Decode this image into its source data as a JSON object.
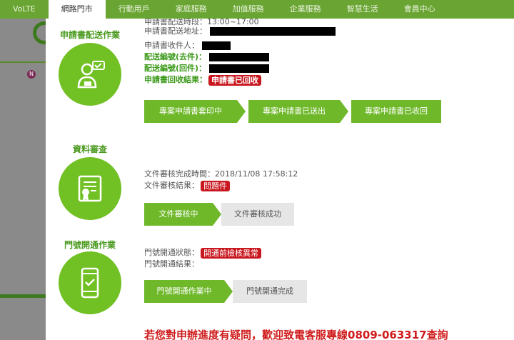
{
  "topnav": {
    "items": [
      {
        "label": "VoLTE"
      },
      {
        "label": "網路門市"
      },
      {
        "label": "行動用戶"
      },
      {
        "label": "家庭服務"
      },
      {
        "label": "加值服務"
      },
      {
        "label": "企業服務"
      },
      {
        "label": "智慧生活"
      },
      {
        "label": "會員中心"
      }
    ],
    "active_index": 1
  },
  "application": {
    "title": "申請書配送作業",
    "icon": "person-presentation-icon",
    "partial_top_text": "申請書配送時段：13:00~17:00",
    "rows": {
      "address_label": "申請書配送地址：",
      "recipient_label": "申請書收件人：",
      "delivery_out_label": "配送編號(去件)：",
      "delivery_back_label": "配送編號(回件)：",
      "result_label": "申請書回收結果：",
      "result_badge": "申請書已回收"
    },
    "steps": [
      "專案申請書套印中",
      "專案申請書已送出",
      "專案申請書已收回"
    ]
  },
  "review": {
    "title": "資料審查",
    "icon": "document-certificate-icon",
    "completed_label": "文件審核完成時間：",
    "completed_time": "2018/11/08 17:58:12",
    "result_label": "文件審核結果：",
    "result_badge": "問題件",
    "steps": [
      "文件審核中",
      "文件審核成功"
    ]
  },
  "activation": {
    "title": "門號開通作業",
    "icon": "smartphone-check-icon",
    "status_label": "門號開通狀態：",
    "status_badge": "開通前檢核異常",
    "result_label": "門號開通結果：",
    "steps": [
      "門號開通作業中",
      "門號開通完成"
    ]
  },
  "footer_note": "若您對申辦進度有疑問，歡迎致電客服專線0809-063317查詢",
  "colors": {
    "nav_green": "#6aa433",
    "circle_green": "#71c024",
    "step_green": "#6fb82a",
    "badge_red": "#c8171e"
  }
}
